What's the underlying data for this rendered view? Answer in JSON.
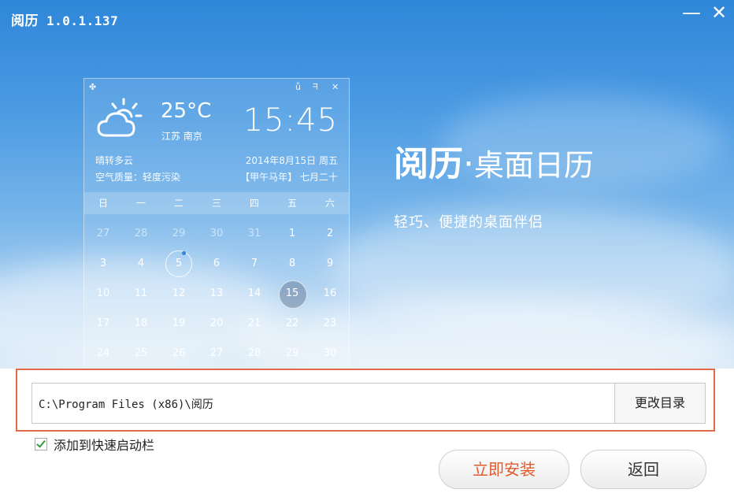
{
  "window": {
    "app_name": "阅历",
    "version": "1.0.1.137",
    "minimize_glyph": "—",
    "close_glyph": "✕"
  },
  "widget": {
    "temperature": "25°C",
    "city": "江苏 南京",
    "time": "15:45",
    "weather": "晴转多云",
    "air_quality": "空气质量：轻度污染",
    "date": "2014年8月15日 周五",
    "lunar_date": "【甲午马年】 七月二十",
    "weekdays": [
      "日",
      "一",
      "二",
      "三",
      "四",
      "五",
      "六"
    ],
    "weeks": [
      [
        "27",
        "28",
        "29",
        "30",
        "31",
        "1",
        "2"
      ],
      [
        "3",
        "4",
        "5",
        "6",
        "7",
        "8",
        "9"
      ],
      [
        "10",
        "11",
        "12",
        "13",
        "14",
        "15",
        "16"
      ],
      [
        "17",
        "18",
        "19",
        "20",
        "21",
        "22",
        "23"
      ],
      [
        "24",
        "25",
        "26",
        "27",
        "28",
        "29",
        "30"
      ]
    ]
  },
  "brand": {
    "name": "阅历",
    "separator": "·",
    "subtitle": "桌面日历",
    "slogan": "轻巧、便捷的桌面伴侣"
  },
  "install": {
    "path": "C:\\Program Files (x86)\\阅历",
    "change_dir_label": "更改目录",
    "quicklaunch_label": "添加到快速启动栏",
    "quicklaunch_checked": true,
    "install_label": "立即安装",
    "back_label": "返回"
  },
  "colors": {
    "accent_orange": "#e05a2a",
    "highlight_border": "#e06b4b",
    "check_green": "#2f9e3a",
    "sky_blue": "#2f86d8"
  }
}
